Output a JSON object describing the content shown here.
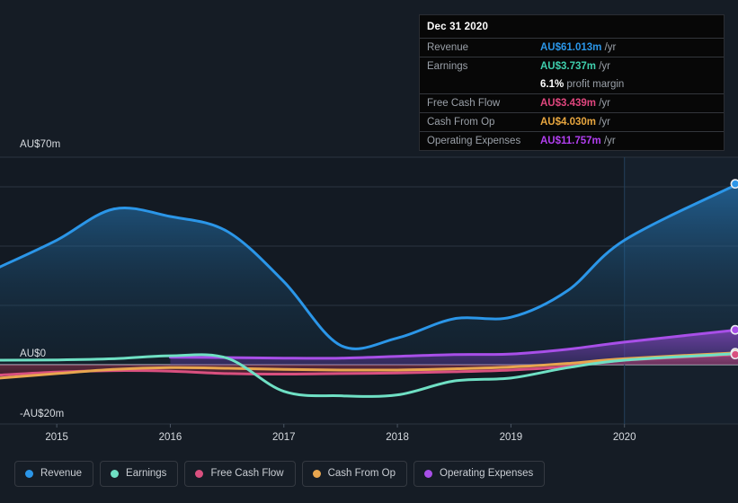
{
  "background_color": "#151c25",
  "currency_prefix": "AU$",
  "tooltip": {
    "date": "Dec 31 2020",
    "rows": [
      {
        "label": "Revenue",
        "value": "AU$61.013m",
        "unit": "/yr",
        "color": "#2b96e8"
      },
      {
        "label": "Earnings",
        "value": "AU$3.737m",
        "unit": "/yr",
        "color": "#3fcfad"
      },
      {
        "label": "Free Cash Flow",
        "value": "AU$3.439m",
        "unit": "/yr",
        "color": "#e0467e"
      },
      {
        "label": "Cash From Op",
        "value": "AU$4.030m",
        "unit": "/yr",
        "color": "#e8a63f"
      },
      {
        "label": "Operating Expenses",
        "value": "AU$11.757m",
        "unit": "/yr",
        "color": "#b23ff0"
      }
    ],
    "profit_margin": {
      "value": "6.1%",
      "text": "profit margin"
    }
  },
  "legend": {
    "items": [
      {
        "label": "Revenue",
        "color": "#2b96e8"
      },
      {
        "label": "Earnings",
        "color": "#6fe0c4"
      },
      {
        "label": "Free Cash Flow",
        "color": "#d9507f"
      },
      {
        "label": "Cash From Op",
        "color": "#e8a64f"
      },
      {
        "label": "Operating Expenses",
        "color": "#a84fe8"
      }
    ]
  },
  "chart_data": {
    "type": "area",
    "title": "",
    "xlabel": "",
    "ylabel": "",
    "grid": true,
    "legend_position": "bottom",
    "y_axis": {
      "labels": [
        "AU$70m",
        "AU$0",
        "-AU$20m"
      ],
      "ylim": [
        -20,
        70
      ],
      "gridlines": [
        70,
        60,
        40,
        20,
        0,
        -20
      ],
      "zero_line": 0
    },
    "x_axis": {
      "tick_labels": [
        "2015",
        "2016",
        "2017",
        "2018",
        "2019",
        "2020"
      ],
      "tick_values": [
        2015,
        2016,
        2017,
        2018,
        2019,
        2020
      ],
      "xlim": [
        2014.5,
        2021.0
      ],
      "forecast_divider": 2020.0
    },
    "series": [
      {
        "name": "Revenue",
        "color": "#2b96e8",
        "x": [
          2014.5,
          2015.0,
          2015.5,
          2016.0,
          2016.5,
          2017.0,
          2017.5,
          2018.0,
          2018.5,
          2019.0,
          2019.5,
          2020.0,
          2021.0
        ],
        "values": [
          33.0,
          42.0,
          52.5,
          50.0,
          45.0,
          28.0,
          6.5,
          9.0,
          15.5,
          16.0,
          25.0,
          42.0,
          61.013
        ]
      },
      {
        "name": "Earnings",
        "color": "#6fe0c4",
        "x": [
          2014.5,
          2015.0,
          2015.5,
          2016.0,
          2016.5,
          2017.0,
          2017.5,
          2018.0,
          2018.5,
          2019.0,
          2019.5,
          2020.0,
          2021.0
        ],
        "values": [
          1.5,
          1.6,
          2.0,
          3.0,
          2.2,
          -9.0,
          -10.5,
          -10.2,
          -5.5,
          -4.5,
          -1.0,
          1.5,
          3.737
        ]
      },
      {
        "name": "Free Cash Flow",
        "color": "#d9507f",
        "x": [
          2014.5,
          2015.0,
          2015.5,
          2016.0,
          2016.5,
          2017.0,
          2017.5,
          2018.0,
          2018.5,
          2019.0,
          2019.5,
          2020.0,
          2021.0
        ],
        "values": [
          -3.5,
          -2.5,
          -2.0,
          -2.2,
          -3.0,
          -3.2,
          -3.0,
          -2.8,
          -2.4,
          -1.8,
          -0.6,
          1.5,
          3.439
        ]
      },
      {
        "name": "Cash From Op",
        "color": "#e8a64f",
        "x": [
          2014.5,
          2015.0,
          2015.5,
          2016.0,
          2016.5,
          2017.0,
          2017.5,
          2018.0,
          2018.5,
          2019.0,
          2019.5,
          2020.0,
          2021.0
        ],
        "values": [
          -4.5,
          -3.0,
          -1.6,
          -1.0,
          -1.2,
          -1.6,
          -1.8,
          -1.8,
          -1.4,
          -0.8,
          0.4,
          2.0,
          4.03
        ]
      },
      {
        "name": "Operating Expenses",
        "color": "#a84fe8",
        "x": [
          2016.0,
          2016.5,
          2017.0,
          2017.5,
          2018.0,
          2018.5,
          2019.0,
          2019.5,
          2020.0,
          2021.0
        ],
        "values": [
          2.5,
          2.4,
          2.2,
          2.2,
          2.8,
          3.4,
          3.6,
          5.2,
          7.6,
          11.757
        ]
      }
    ]
  }
}
